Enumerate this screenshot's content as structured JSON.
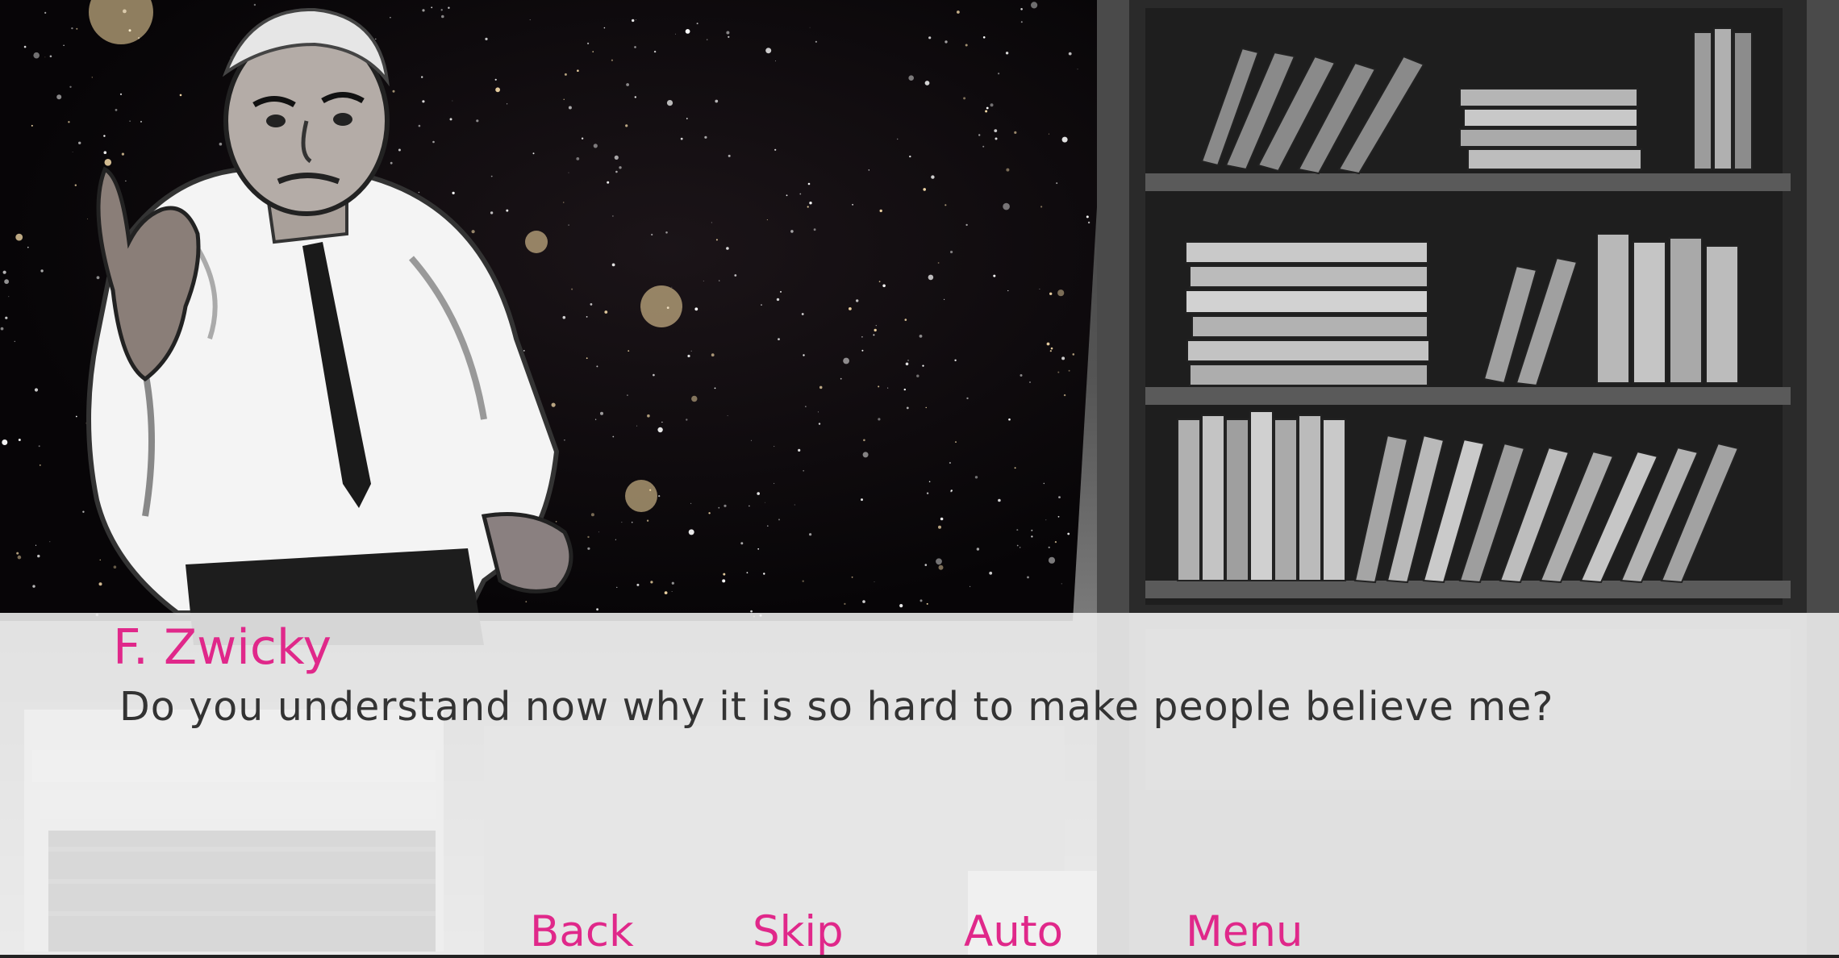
{
  "dialogue": {
    "speaker": "F. Zwicky",
    "text": "Do you understand now why it is so hard to make people believe me?"
  },
  "quick_menu": {
    "back_label": "Back",
    "skip_label": "Skip",
    "auto_label": "Auto",
    "menu_label": "Menu"
  },
  "colors": {
    "accent": "#e0288a",
    "dialogue_text": "#333333",
    "dialogue_box": "#f0f0f0"
  }
}
